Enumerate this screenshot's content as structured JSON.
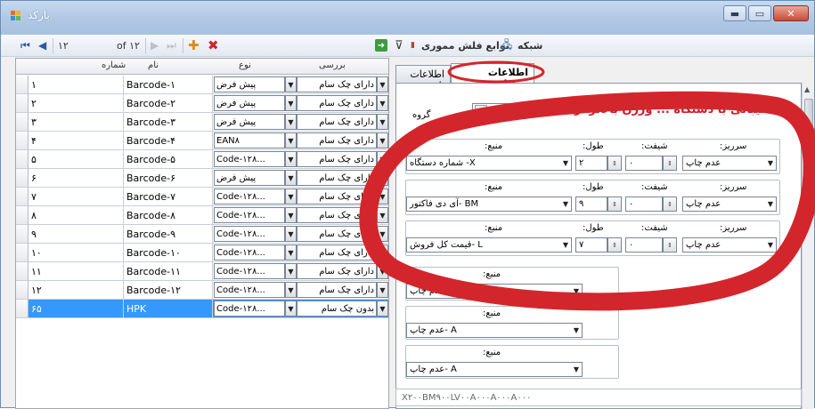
{
  "window": {
    "title": "بارکد",
    "min": "▬",
    "max": "▭",
    "close": "✕"
  },
  "toolbar": {
    "first": "⏮",
    "prev": "◀",
    "position": "۱۲",
    "of_label": "of ۱۲",
    "next": "▶",
    "last": "⏭",
    "add": "✚",
    "delete": "✖",
    "right_items": [
      "شبکه",
      "توابع فلش مموری"
    ],
    "go": "➜",
    "filter": "⊽"
  },
  "grid": {
    "columns": [
      "شماره",
      "نام",
      "نوع",
      "بررسی"
    ],
    "rows": [
      {
        "num": "۱",
        "name": "Barcode-۱",
        "type": "پیش فرض",
        "check": "دارای چک سام"
      },
      {
        "num": "۲",
        "name": "Barcode-۲",
        "type": "پیش فرض",
        "check": "دارای چک سام"
      },
      {
        "num": "۳",
        "name": "Barcode-۳",
        "type": "پیش فرض",
        "check": "دارای چک سام"
      },
      {
        "num": "۴",
        "name": "Barcode-۴",
        "type": "EAN۸",
        "check": "دارای چک سام"
      },
      {
        "num": "۵",
        "name": "Barcode-۵",
        "type": "Code-۱۲۸...",
        "check": "دارای چک سام"
      },
      {
        "num": "۶",
        "name": "Barcode-۶",
        "type": "پیش فرض",
        "check": "دارای چک سام"
      },
      {
        "num": "۷",
        "name": "Barcode-۷",
        "type": "Code-۱۲۸...",
        "check": "دارای چک سام"
      },
      {
        "num": "۸",
        "name": "Barcode-۸",
        "type": "Code-۱۲۸...",
        "check": "دارای چک سام"
      },
      {
        "num": "۹",
        "name": "Barcode-۹",
        "type": "Code-۱۲۸...",
        "check": "دارای چک سام"
      },
      {
        "num": "۱۰",
        "name": "Barcode-۱۰",
        "type": "Code-۱۲۸...",
        "check": "دارای چک سام"
      },
      {
        "num": "۱۱",
        "name": "Barcode-۱۱",
        "type": "Code-۱۲۸...",
        "check": "دارای چک سام"
      },
      {
        "num": "۱۲",
        "name": "Barcode-۱۲",
        "type": "Code-۱۲۸...",
        "check": "دارای چک سام"
      },
      {
        "num": "۶۵",
        "name": "HPK",
        "type": "Code-۱۲۸...",
        "check": "بدون چک سام"
      }
    ]
  },
  "tabs": [
    "اطلاعات جزئیات",
    "اطلاعات پایه"
  ],
  "details": {
    "warning": "پشتیبانی با دستگاه ... ورژن بالاتر از ۲٫۱۸",
    "group_label": "گروه",
    "group_value": "۶",
    "fs_labels": {
      "source": "منبع:",
      "length": "طول:",
      "shift": "شیفت:",
      "overflow": "سرریز:"
    },
    "fieldsets": [
      {
        "source": "شماره دستگاه -X",
        "length": "۲",
        "shift": "۰",
        "overflow": "عدم چاپ"
      },
      {
        "source": "آی دی فاکتور- BM",
        "length": "۹",
        "shift": "۰",
        "overflow": "عدم چاپ"
      },
      {
        "source": "قیمت کل فروش- L",
        "length": "۷",
        "shift": "۰",
        "overflow": "عدم چاپ"
      },
      {
        "source": "عدم چاپ- A"
      },
      {
        "source": "عدم چاپ- A"
      },
      {
        "source": "عدم چاپ- A"
      }
    ],
    "pattern": "X۲۰۰BM۹۰۰LV۰۰A۰۰۰A۰۰۰A۰۰۰"
  }
}
